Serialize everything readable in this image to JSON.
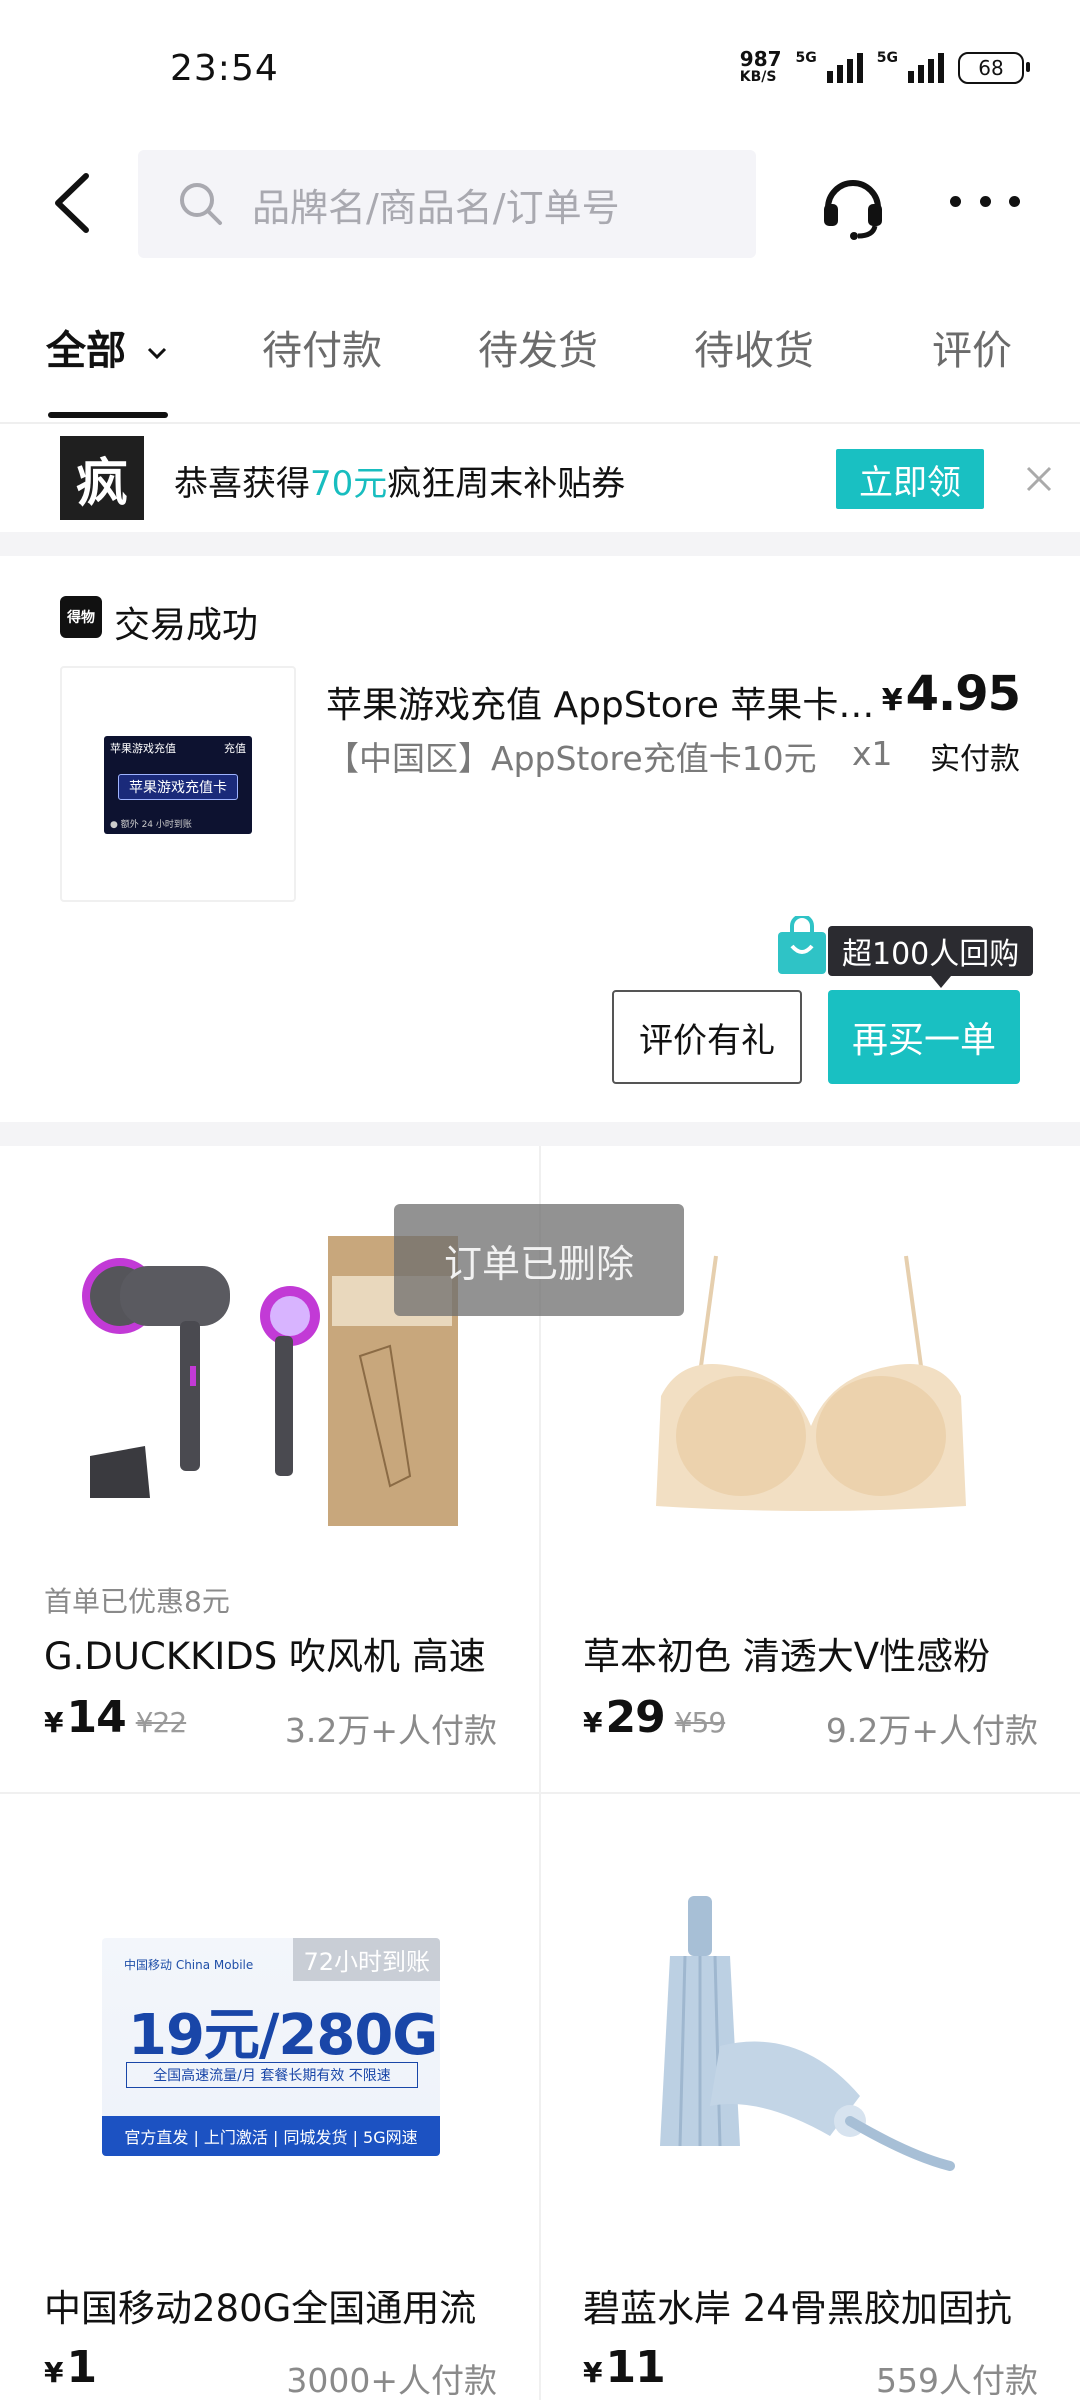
{
  "status_bar": {
    "time": "23:54",
    "net_speed": "987",
    "net_unit": "KB/S",
    "sim1_label": "5G",
    "sim2_label": "5G",
    "battery": "68"
  },
  "header": {
    "search_placeholder": "品牌名/商品名/订单号",
    "icons": [
      "back-icon",
      "search-icon",
      "headset-icon",
      "more-icon"
    ]
  },
  "tabs": [
    {
      "label": "全部",
      "active": true
    },
    {
      "label": "待付款"
    },
    {
      "label": "待发货"
    },
    {
      "label": "待收货"
    },
    {
      "label": "评价"
    }
  ],
  "coupon": {
    "logo_char": "疯",
    "text_before": "恭喜获得",
    "amount": "70元",
    "text_after": "疯狂周末补贴券",
    "button": "立即领"
  },
  "order": {
    "store_icon_text": "得物",
    "status": "交易成功",
    "title": "苹果游戏充值 AppStore 苹果卡充值 苹果充值",
    "subtitle": "【中国区】AppStore充值卡10元",
    "quantity": "x1",
    "currency": "¥",
    "price": "4.95",
    "price_note": "实付款",
    "thumb": {
      "header_left": "苹果游戏充值",
      "header_right": "充值",
      "center": "苹果游戏充值卡",
      "footer": "● 额外 24 小时到账"
    },
    "rebuy_tip": "超100人回购",
    "review_button": "评价有礼",
    "rebuy_button": "再买一单"
  },
  "toast": "订单已删除",
  "products": [
    {
      "promo": "首单已优惠8元",
      "title": "G.DUCKKIDS 吹风机 高速",
      "currency": "¥",
      "price": "14",
      "old_price": "¥22",
      "sales": "3.2万+人付款",
      "image": "hair-dryer-image"
    },
    {
      "promo": "",
      "title": "草本初色 清透大V性感粉",
      "currency": "¥",
      "price": "29",
      "old_price": "¥59",
      "sales": "9.2万+人付款",
      "image": "bra-image"
    },
    {
      "promo": "",
      "title": "中国移动280G全国通用流",
      "currency": "¥",
      "price": "1",
      "old_price": "",
      "sales": "3000+人付款",
      "image": "sim-card-image"
    },
    {
      "promo": "",
      "title": "碧蓝水岸 24骨黑胶加固抗",
      "currency": "¥",
      "price": "11",
      "old_price": "",
      "sales": "559人付款",
      "image": "umbrella-image"
    }
  ],
  "sim_card": {
    "tag": "72小时到账",
    "logo": "中国移动 China Mobile",
    "headline": "19元/280G",
    "box_text": "全国高速流量/月 套餐长期有效 不限速",
    "bar_text": "官方直发 | 上门激活 | 同城发货 | 5G网速"
  },
  "colors": {
    "accent": "#19c0c2",
    "highlight": "#18bdbf",
    "text": "#111111",
    "muted": "#8a8a8a"
  }
}
